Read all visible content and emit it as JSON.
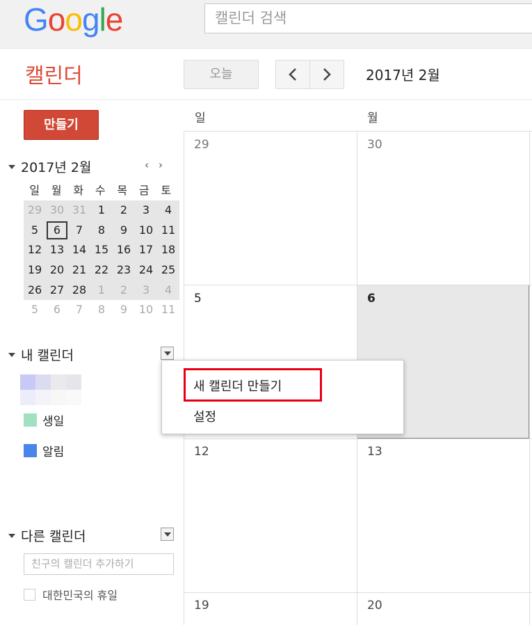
{
  "header": {
    "logo_letters": [
      {
        "ch": "G",
        "color": "#4285f4"
      },
      {
        "ch": "o",
        "color": "#ea4335"
      },
      {
        "ch": "o",
        "color": "#fbbc05"
      },
      {
        "ch": "g",
        "color": "#4285f4"
      },
      {
        "ch": "l",
        "color": "#34a853"
      },
      {
        "ch": "e",
        "color": "#ea4335"
      }
    ],
    "search_placeholder": "캘린더 검색",
    "app_title": "캘린더",
    "today_button": "오늘",
    "prev_icon": "chevron-left-icon",
    "next_icon": "chevron-right-icon",
    "current_period": "2017년 2월"
  },
  "sidebar": {
    "create_button": "만들기",
    "mini_calendar": {
      "title": "2017년 2월",
      "weekdays": [
        "일",
        "월",
        "화",
        "수",
        "목",
        "금",
        "토"
      ],
      "weeks": [
        [
          "29",
          "30",
          "31",
          "1",
          "2",
          "3",
          "4"
        ],
        [
          "5",
          "6",
          "7",
          "8",
          "9",
          "10",
          "11"
        ],
        [
          "12",
          "13",
          "14",
          "15",
          "16",
          "17",
          "18"
        ],
        [
          "19",
          "20",
          "21",
          "22",
          "23",
          "24",
          "25"
        ],
        [
          "26",
          "27",
          "28",
          "1",
          "2",
          "3",
          "4"
        ],
        [
          "5",
          "6",
          "7",
          "8",
          "9",
          "10",
          "11"
        ]
      ],
      "today": "6"
    },
    "my_calendars": {
      "title": "내 캘린더",
      "items": [
        {
          "label": "생일",
          "color": "#9fe1c1"
        },
        {
          "label": "알림",
          "color": "#4a86e8"
        }
      ]
    },
    "other_calendars": {
      "title": "다른 캘린더",
      "add_placeholder": "친구의 캘린더 추가하기",
      "items": [
        {
          "label": "대한민국의 휴일"
        }
      ]
    }
  },
  "calendar": {
    "weekday_headers": [
      "일",
      "월"
    ],
    "weeks": [
      [
        "29",
        "30"
      ],
      [
        "5",
        "6"
      ],
      [
        "12",
        "13"
      ],
      [
        "19",
        "20"
      ]
    ],
    "today": "6"
  },
  "context_menu": {
    "items": [
      "새 캘린더 만들기",
      "설정"
    ]
  },
  "colors": {
    "accent_red": "#dd4b39",
    "create_button": "#d14836",
    "highlight_box": "#e60012"
  }
}
